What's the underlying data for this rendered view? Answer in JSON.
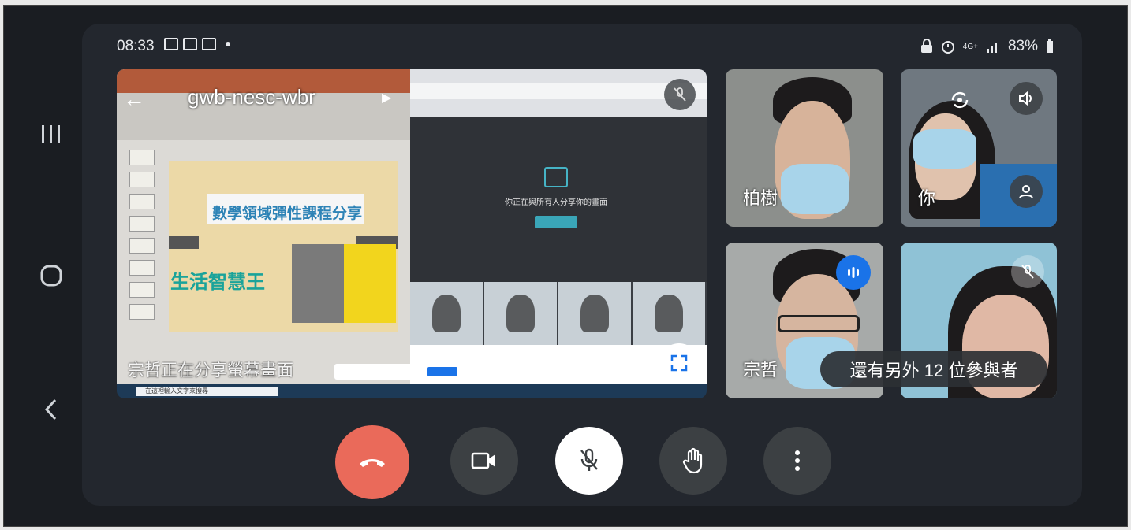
{
  "status_bar": {
    "time": "08:33",
    "battery": "83%",
    "network": "4G+"
  },
  "presentation": {
    "meeting_code": "gwb-nesc-wbr",
    "slide_title": "數學領域彈性課程分享",
    "slide_subtitle": "生活智慧王",
    "presenter_caption": "宗哲正在分享螢幕畫面",
    "inner_share_text": "你正在與所有人分享你的畫面",
    "taskbar_search": "在這裡輸入文字來搜尋"
  },
  "participants": [
    {
      "name": "柏樹"
    },
    {
      "name": "你"
    },
    {
      "name": "宗哲"
    },
    {
      "name": ""
    }
  ],
  "more_participants": "還有另外 12 位參與者",
  "controls": {
    "end_call": "end-call-icon",
    "camera": "camera-icon",
    "mic": "mic-off-icon",
    "raise_hand": "hand-icon",
    "more": "more-vert-icon"
  },
  "colors": {
    "end_call": "#ea6a5a",
    "speaking": "#1a73e8",
    "background": "#23272e"
  }
}
